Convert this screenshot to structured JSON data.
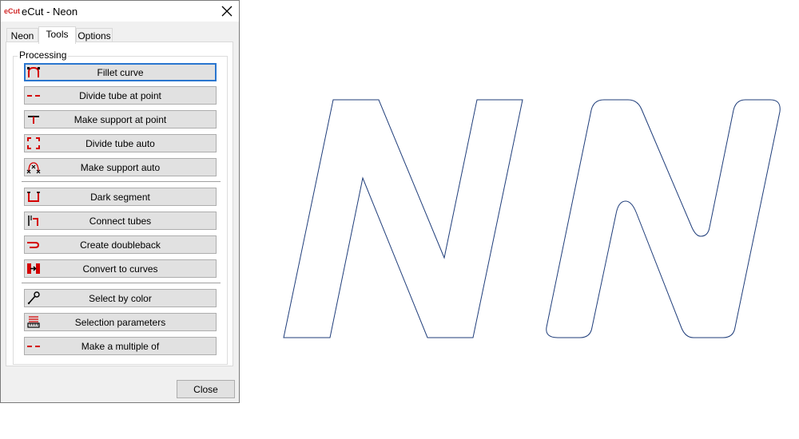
{
  "window": {
    "app_logo": "eCut",
    "title": "eCut - Neon",
    "close_icon": "close-icon"
  },
  "tabs": [
    {
      "label": "Neon",
      "active": false
    },
    {
      "label": "Tools",
      "active": true
    },
    {
      "label": "Options",
      "active": false
    }
  ],
  "processing": {
    "label": "Processing",
    "tools": [
      {
        "label": "Fillet curve",
        "icon": "fillet-curve-icon",
        "focused": true
      },
      {
        "label": "Divide tube at point",
        "icon": "divide-tube-icon"
      },
      {
        "label": "Make support at point",
        "icon": "support-icon"
      },
      {
        "label": "Divide tube auto",
        "icon": "divide-auto-icon"
      },
      {
        "label": "Make support auto",
        "icon": "support-auto-icon"
      },
      {
        "label": "Dark segment",
        "icon": "dark-segment-icon"
      },
      {
        "label": "Connect tubes",
        "icon": "connect-tubes-icon"
      },
      {
        "label": "Create doubleback",
        "icon": "doubleback-icon"
      },
      {
        "label": "Convert to curves",
        "icon": "convert-curves-icon"
      },
      {
        "label": "Select by color",
        "icon": "eyedropper-icon"
      },
      {
        "label": "Selection parameters",
        "icon": "selection-params-icon"
      },
      {
        "label": "Make a multiple of",
        "icon": "multiple-of-icon"
      }
    ]
  },
  "buttons": {
    "close": "Close"
  },
  "colors": {
    "accent": "#2a76cf",
    "icon_red": "#d40000",
    "outline": "#1f3d7a"
  }
}
